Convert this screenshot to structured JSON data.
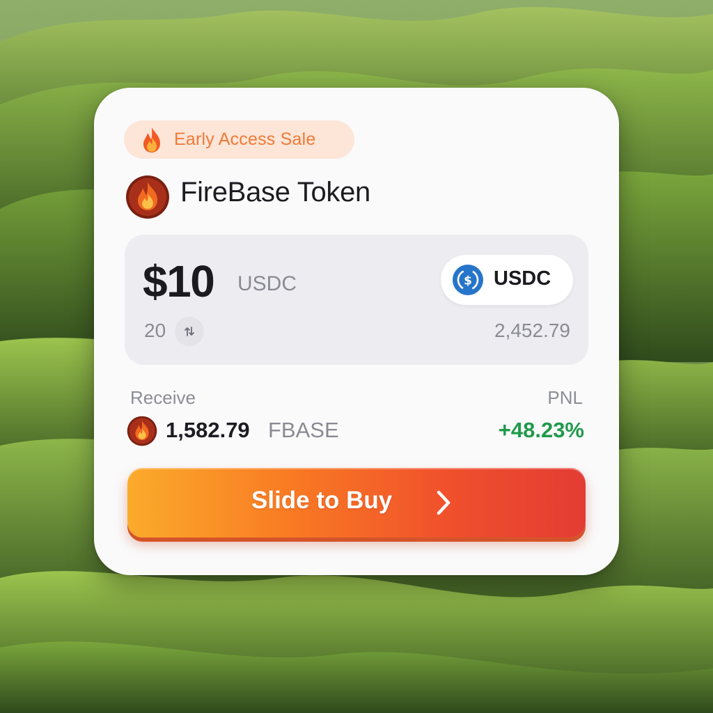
{
  "badge": {
    "icon": "fire-icon",
    "label": "Early Access Sale"
  },
  "token": {
    "icon": "firebase-token-logo",
    "name": "FireBase Token"
  },
  "pay": {
    "amount": "$10",
    "unit": "USDC",
    "selector": {
      "icon": "usdc-icon",
      "label": "USDC"
    },
    "sub_amount": "20",
    "swap_icon": "swap-arrows-icon",
    "balance": "2,452.79"
  },
  "receive": {
    "label": "Receive",
    "amount": "1,582.79",
    "unit": "FBASE",
    "icon": "firebase-token-logo"
  },
  "pnl": {
    "label": "PNL",
    "value": "+48.23%"
  },
  "action": {
    "label": "Slide to Buy",
    "icon": "chevron-right-icon"
  },
  "colors": {
    "accent_orange": "#f97b23",
    "badge_text": "#ef7a37",
    "pnl_green": "#1f9a4b",
    "usdc_blue": "#2775ca"
  }
}
